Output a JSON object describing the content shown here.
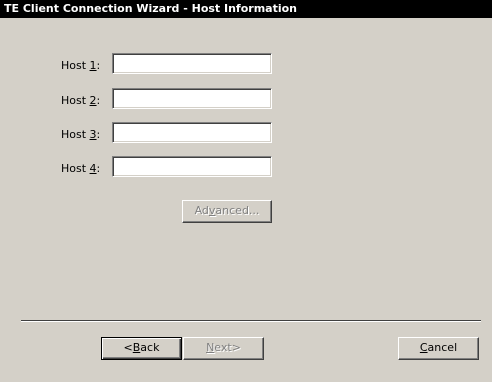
{
  "window": {
    "title": "TE Client Connection Wizard - Host Information"
  },
  "hosts": [
    {
      "label_prefix": "Host ",
      "accel": "1",
      "label_suffix": ":",
      "value": ""
    },
    {
      "label_prefix": "Host ",
      "accel": "2",
      "label_suffix": ":",
      "value": ""
    },
    {
      "label_prefix": "Host ",
      "accel": "3",
      "label_suffix": ":",
      "value": ""
    },
    {
      "label_prefix": "Host ",
      "accel": "4",
      "label_suffix": ":",
      "value": ""
    }
  ],
  "advanced_button": {
    "prefix": "Ad",
    "accel": "v",
    "suffix": "anced...",
    "enabled": false
  },
  "footer": {
    "back": {
      "prefix": "<",
      "accel": "B",
      "suffix": "ack",
      "enabled": true
    },
    "next": {
      "prefix": "",
      "accel": "N",
      "suffix": "ext>",
      "enabled": false
    },
    "cancel": {
      "prefix": "",
      "accel": "C",
      "suffix": "ancel",
      "enabled": true
    }
  },
  "colors": {
    "dialog_background": "#d4d0c8",
    "titlebar_background": "#000000",
    "titlebar_text": "#ffffff",
    "disabled_text": "#808080"
  }
}
